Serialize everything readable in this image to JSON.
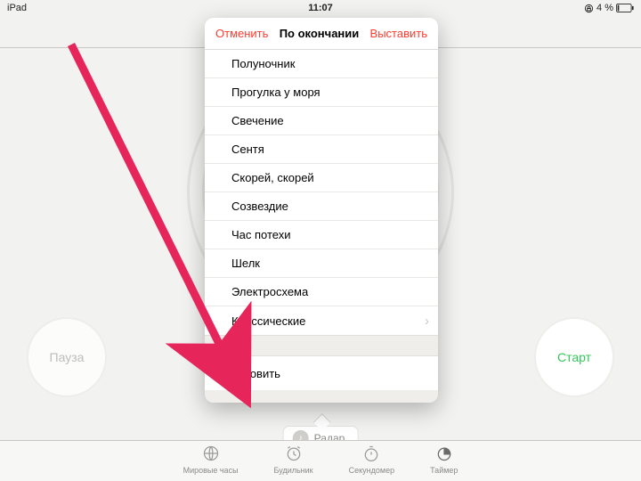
{
  "status": {
    "device": "iPad",
    "time": "11:07",
    "battery": "4 %"
  },
  "popover": {
    "cancel": "Отменить",
    "title": "По окончании",
    "set": "Выставить",
    "items": [
      {
        "label": "Полуночник"
      },
      {
        "label": "Прогулка у моря"
      },
      {
        "label": "Свечение"
      },
      {
        "label": "Сентя"
      },
      {
        "label": "Скорей, скорей"
      },
      {
        "label": "Созвездие"
      },
      {
        "label": "Час потехи"
      },
      {
        "label": "Шелк"
      },
      {
        "label": "Электросхема"
      },
      {
        "label": "Классические",
        "disclosure": true
      }
    ],
    "stop": "Остановить"
  },
  "buttons": {
    "pause": "Пауза",
    "start": "Старт"
  },
  "sound": {
    "label": "Радар"
  },
  "tabs": [
    {
      "label": "Мировые часы"
    },
    {
      "label": "Будильник"
    },
    {
      "label": "Секундомер"
    },
    {
      "label": "Таймер"
    }
  ]
}
